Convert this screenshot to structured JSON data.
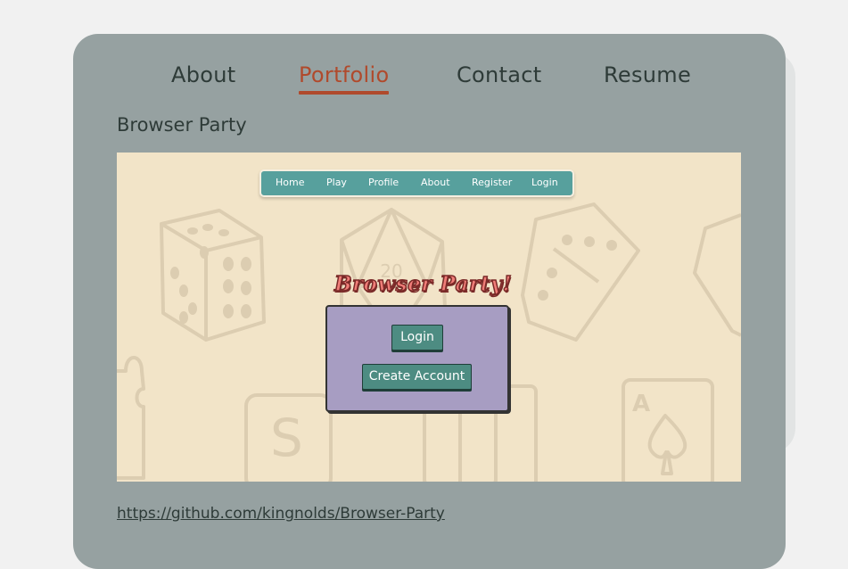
{
  "nav": {
    "items": [
      {
        "label": "About"
      },
      {
        "label": "Portfolio"
      },
      {
        "label": "Contact"
      },
      {
        "label": "Resume"
      }
    ],
    "active": "Portfolio"
  },
  "project": {
    "title": "Browser Party",
    "link": "https://github.com/kingnolds/Browser-Party"
  },
  "preview": {
    "nav_items": [
      "Home",
      "Play",
      "Profile",
      "About",
      "Register",
      "Login"
    ],
    "logo": "Browser Party!",
    "login_button": "Login",
    "create_button": "Create Account",
    "d20_label": "20",
    "card_letter": "A",
    "tile_letter": "S"
  },
  "colors": {
    "accent": "#b04a2c",
    "card_bg": "#96a1a1",
    "preview_bg": "#f2e4c8",
    "inner_nav": "#57a09d",
    "login_box": "#a79dc2",
    "button": "#4d8c82"
  }
}
